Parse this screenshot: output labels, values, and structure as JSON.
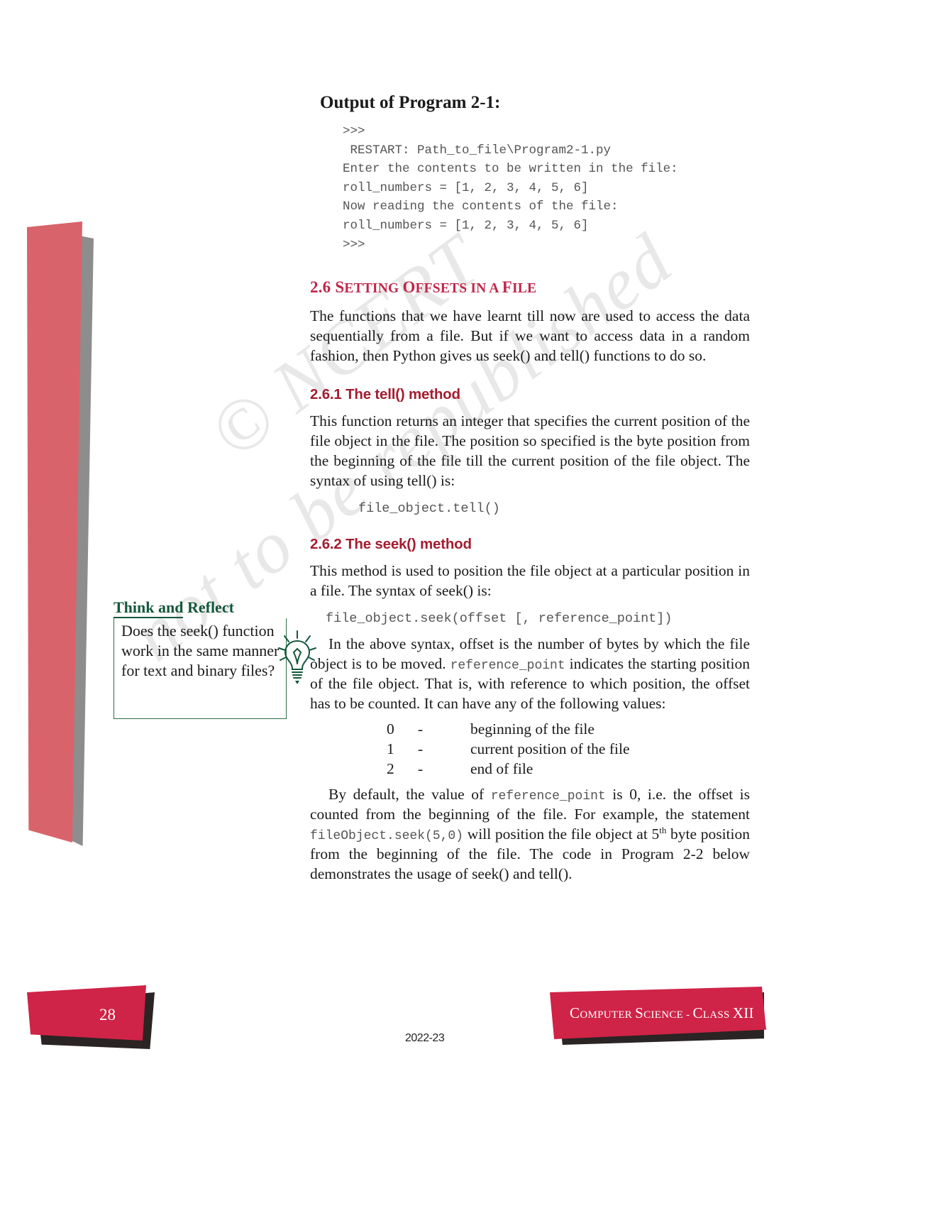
{
  "page": {
    "number": "28",
    "year": "2022-23",
    "footer_label_parts": [
      "C",
      "omputer ",
      "S",
      "cience - ",
      "C",
      "lass ",
      "XII"
    ],
    "footer_label": "Computer Science - Class XII",
    "watermark_line1": "© NCERT",
    "watermark_line2": "not to be republished"
  },
  "output_section": {
    "title": "Output of Program 2-1:",
    "lines": [
      ">>>",
      " RESTART: Path_to_file\\Program2-1.py",
      "Enter the contents to be written in the file:",
      "roll_numbers = [1, 2, 3, 4, 5, 6]",
      "Now reading the contents of the file:",
      "roll_numbers = [1, 2, 3, 4, 5, 6]",
      ">>>"
    ]
  },
  "section": {
    "number": "2.6",
    "title_smallcaps": "Setting Offsets in a File",
    "title_parts": [
      "S",
      "etting ",
      "O",
      "ffsets ",
      "in a ",
      "F",
      "ile"
    ],
    "intro": "The functions that we have learnt till now are used to access the data sequentially from a file. But if we want to access data in a random fashion, then Python gives us seek() and tell() functions to do so."
  },
  "subsection_tell": {
    "heading": "2.6.1 The tell() method",
    "body": "This function returns an integer that specifies the current position of the file object in the file. The position so specified is the byte position from the beginning of the file till the current position of the file object. The syntax of using tell() is:",
    "syntax": "file_object.tell()"
  },
  "subsection_seek": {
    "heading": "2.6.2 The seek() method",
    "body": "This method is used to position the file object at a particular position in a file. The syntax of seek() is:",
    "syntax": "file_object.seek(offset [, reference_point])",
    "explain_1_a": "In the above syntax, offset is the number of bytes by which the file object is to be moved. ",
    "explain_1_code": "reference_point",
    "explain_1_b": " indicates the starting position of the file object. That is, with reference to which position, the offset has to be counted. It can have any of the following values:",
    "values": [
      {
        "num": "0",
        "dash": "-",
        "desc": "beginning of the file"
      },
      {
        "num": "1",
        "dash": "-",
        "desc": "current position of the file"
      },
      {
        "num": "2",
        "dash": "-",
        "desc": "end of file"
      }
    ],
    "explain_2_a": "By default, the value of ",
    "explain_2_code1": "reference_point",
    "explain_2_b": " is 0, i.e. the offset is counted from the beginning of the file. For example, the statement ",
    "explain_2_code2": "fileObject.seek(5,0)",
    "explain_2_c": " will position the file object at 5",
    "explain_2_ord": "th",
    "explain_2_d": " byte position from the beginning of the file. The code in Program 2-2 below demonstrates the usage of seek() and tell()."
  },
  "think_reflect": {
    "title_underlined": "Think and",
    "title_rest": " Reflect",
    "question": "Does the seek() function work in the same manner for text and binary files?",
    "icon": "lightbulb-icon",
    "accent_color": "#14573c"
  },
  "colors": {
    "heading_red": "#c0274a",
    "subheading_red": "#a51c30",
    "badge_red": "#cf2347",
    "bar_red": "#d9636a",
    "bar_gray": "#8d8d8d",
    "green": "#14573c",
    "code_gray": "#555555"
  }
}
